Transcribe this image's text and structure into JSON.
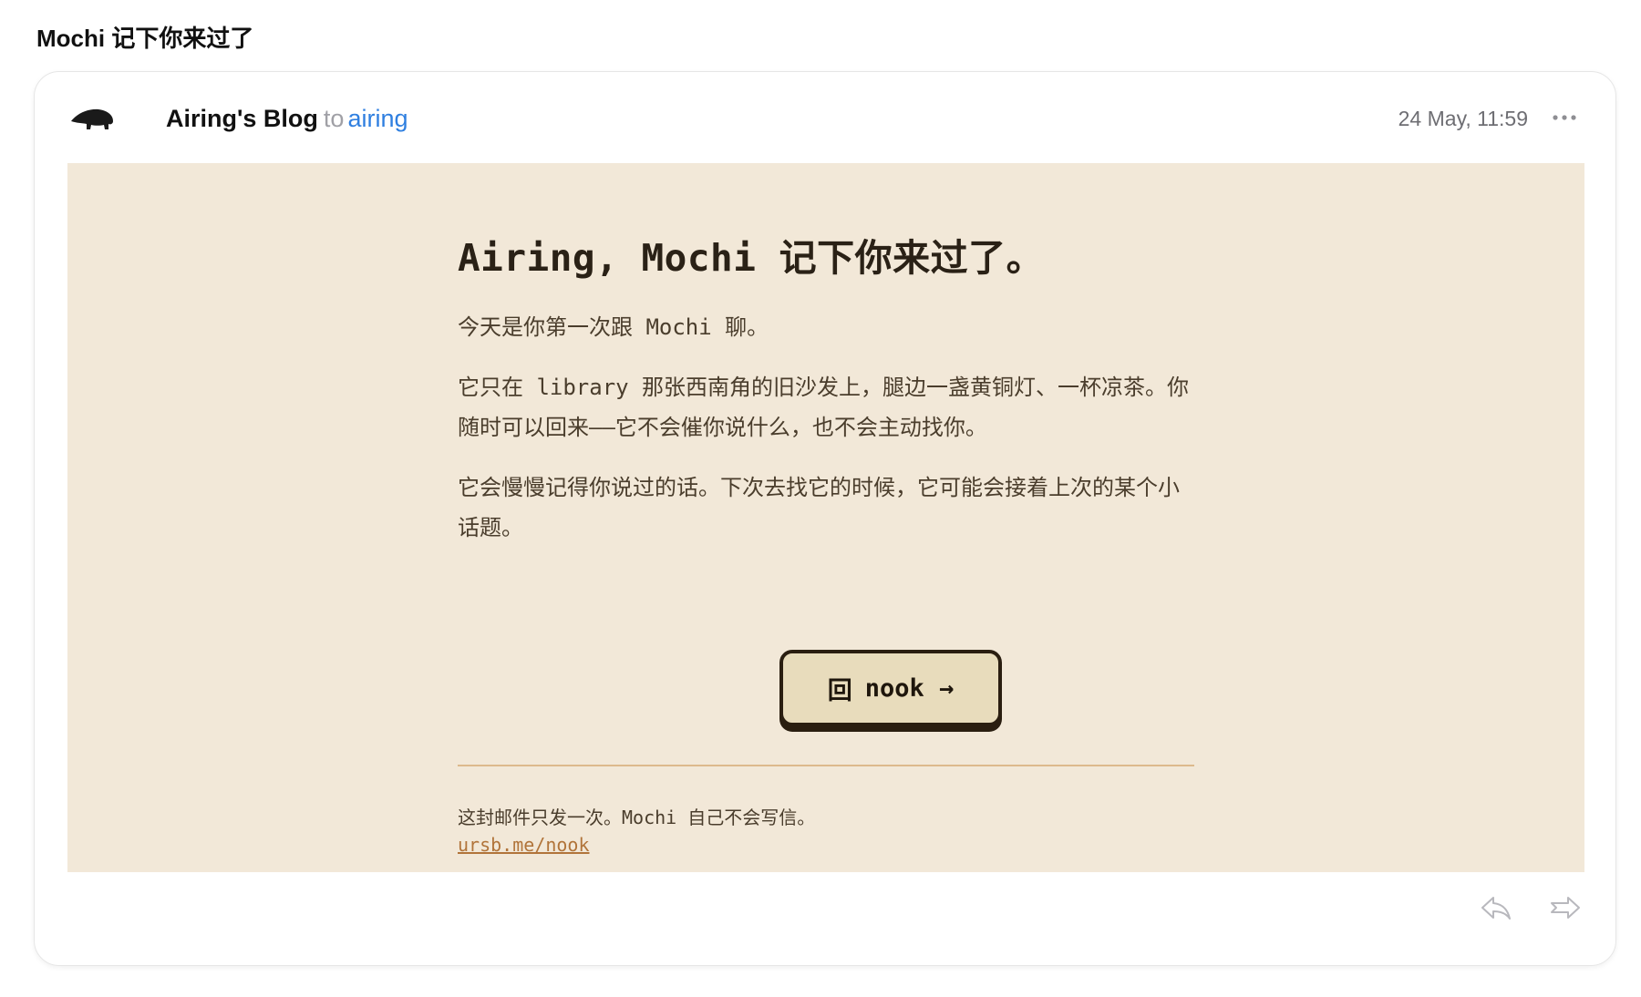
{
  "subject": "Mochi 记下你来过了",
  "header": {
    "sender": "Airing's Blog",
    "to_word": "to",
    "recipient": "airing",
    "date": "24 May, 11:59",
    "avatar_icon": "anteater-silhouette-icon",
    "more_icon": "more-horizontal-icon"
  },
  "email": {
    "headline": "Airing, Mochi 记下你来过了。",
    "paragraphs": [
      "今天是你第一次跟 Mochi 聊。",
      "它只在 library 那张西南角的旧沙发上，腿边一盏黄铜灯、一杯凉茶。你随时可以回来——它不会催你说什么，也不会主动找你。",
      "它会慢慢记得你说过的话。下次去找它的时候，它可能会接着上次的某个小话题。"
    ],
    "button_icon": "回",
    "button_label": "nook →",
    "footer_note": "这封邮件只发一次。Mochi 自己不会写信。",
    "footer_link": "ursb.me/nook"
  },
  "actions": {
    "reply_icon": "reply-icon",
    "forward_icon": "forward-icon"
  },
  "colors": {
    "email_background": "#f2e8d8",
    "button_background": "#e8dcbc",
    "link": "#b1743a",
    "recipient": "#2f7fe0"
  }
}
